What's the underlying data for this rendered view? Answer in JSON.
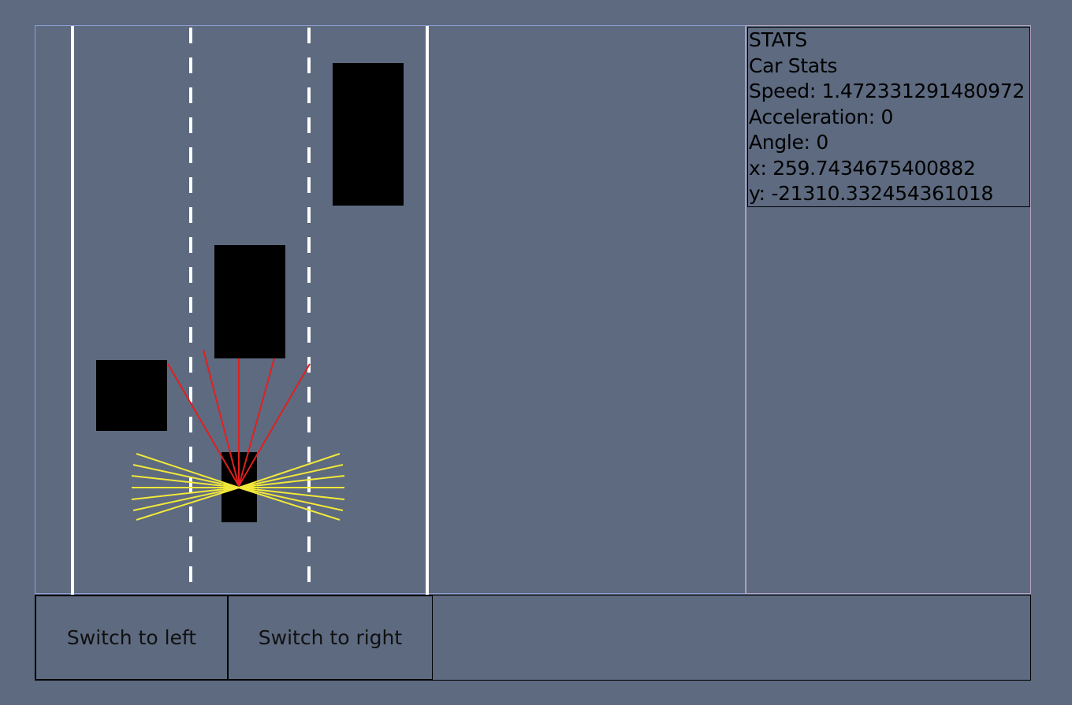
{
  "controls": {
    "switch_left_label": "Switch to left",
    "switch_right_label": "Switch to right"
  },
  "stats": {
    "heading": "STATS",
    "subheading": "Car Stats",
    "speed": "Speed: 1.472331291480972",
    "acceleration": "Acceleration: 0",
    "angle": "Angle: 0",
    "x": "x: 259.7434675400882",
    "y": "y: -21310.332454361018"
  },
  "colors": {
    "background": "#5d6a80",
    "road_line": "#ffffff",
    "car": "#000000",
    "front_sensor": "#e02020",
    "side_sensor": "#f2e83a"
  }
}
